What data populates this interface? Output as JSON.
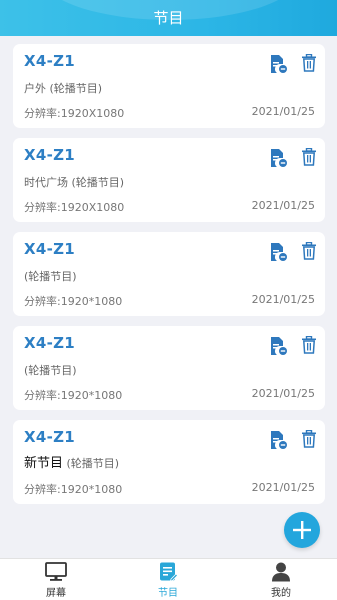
{
  "header": {
    "title": "节目"
  },
  "programs": [
    {
      "name": "X4-Z1",
      "desc_big": "",
      "desc": "户外 (轮播节目)",
      "resolution": "分辨率:1920X1080",
      "date": "2021/01/25"
    },
    {
      "name": "X4-Z1",
      "desc_big": "",
      "desc": "时代广场 (轮播节目)",
      "resolution": "分辨率:1920X1080",
      "date": "2021/01/25"
    },
    {
      "name": "X4-Z1",
      "desc_big": "",
      "desc": "(轮播节目)",
      "resolution": "分辨率:1920*1080",
      "date": "2021/01/25"
    },
    {
      "name": "X4-Z1",
      "desc_big": "",
      "desc": "(轮播节目)",
      "resolution": "分辨率:1920*1080",
      "date": "2021/01/25"
    },
    {
      "name": "X4-Z1",
      "desc_big": "新节目",
      "desc": " (轮播节目)",
      "resolution": "分辨率:1920*1080",
      "date": "2021/01/25"
    }
  ],
  "fab": {
    "icon": "plus-icon"
  },
  "tabbar": {
    "items": [
      {
        "label": "屏幕",
        "icon": "monitor-icon"
      },
      {
        "label": "节目",
        "icon": "program-document-icon",
        "active": true
      },
      {
        "label": "我的",
        "icon": "user-profile-icon"
      }
    ]
  },
  "colors": {
    "accent": "#2cb6e6",
    "title_blue": "#2d7fc4",
    "icon_blue": "#2e78bd",
    "background": "#f0f1f6"
  }
}
